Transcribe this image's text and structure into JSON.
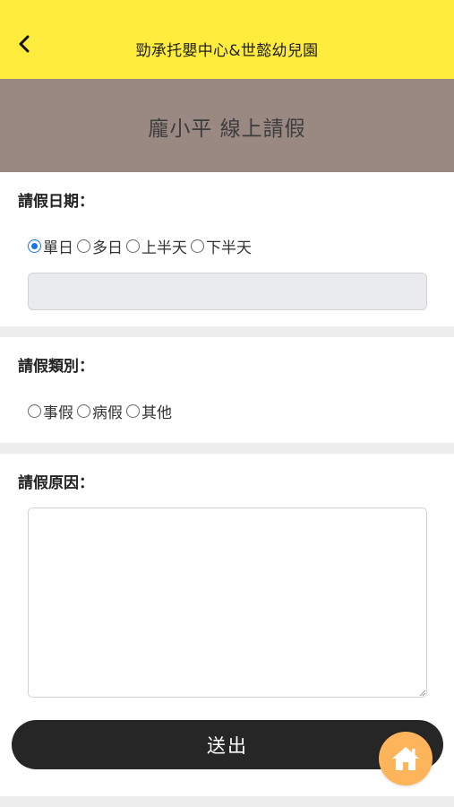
{
  "header": {
    "title": "勁承托嬰中心&世懿幼兒園",
    "back_icon": "chevron-left-icon",
    "background": "#ffec3d"
  },
  "banner": {
    "title": "龐小平 線上請假",
    "background": "#9a8983"
  },
  "leave_date": {
    "label": "請假日期：",
    "options": [
      "單日",
      "多日",
      "上半天",
      "下半天"
    ],
    "selected": "單日",
    "date_value": ""
  },
  "leave_type": {
    "label": "請假類別：",
    "options": [
      "事假",
      "病假",
      "其他"
    ],
    "selected": ""
  },
  "leave_reason": {
    "label": "請假原因：",
    "value": "",
    "placeholder": ""
  },
  "submit": {
    "label": "送出",
    "background": "#262626"
  },
  "home_button": {
    "icon": "home-icon",
    "background": "#fdb45a"
  }
}
